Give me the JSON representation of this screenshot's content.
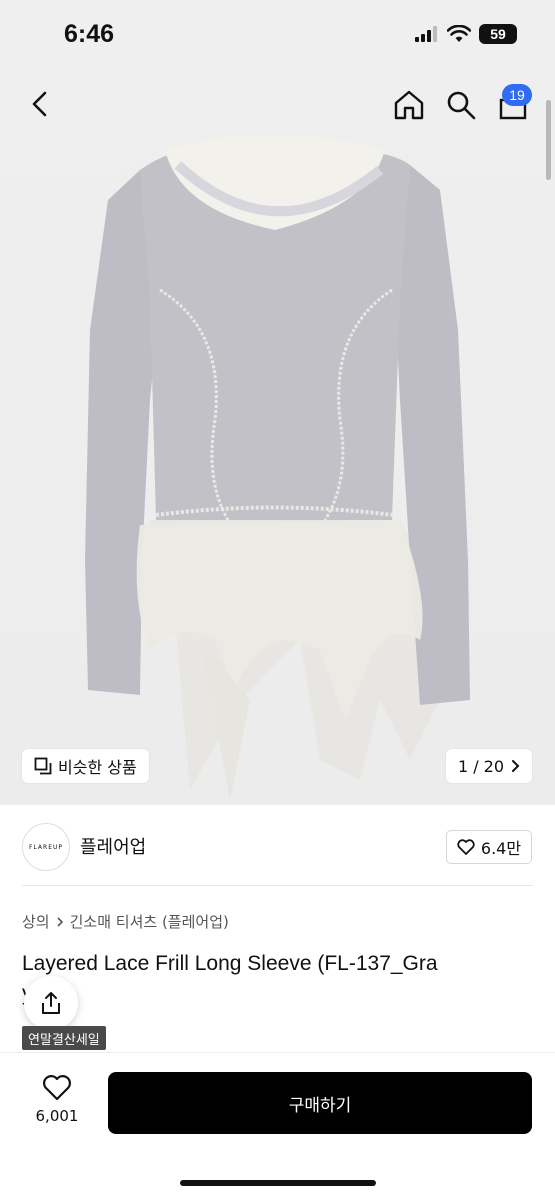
{
  "status_bar": {
    "time": "6:46",
    "battery": "59"
  },
  "nav": {
    "cart_count": "19"
  },
  "gallery": {
    "similar_label": "비슷한 상품",
    "counter": "1 / 20"
  },
  "brand": {
    "logo_text": "FLAREUP",
    "name": "플레어업",
    "likes": "6.4만"
  },
  "breadcrumb": {
    "category": "상의",
    "subcategory": "긴소매 티셔츠 (플레어업)"
  },
  "product": {
    "title": "Layered Lace Frill Long Sleeve (FL-137_Gra",
    "title_cont": "y)",
    "sale_badge": "연말결산세일"
  },
  "bottom": {
    "wish_count": "6,001",
    "buy_label": "구매하기"
  },
  "colors": {
    "accent": "#2f6bf5",
    "buy_button": "#000000",
    "garment": "#bdbcc4"
  }
}
